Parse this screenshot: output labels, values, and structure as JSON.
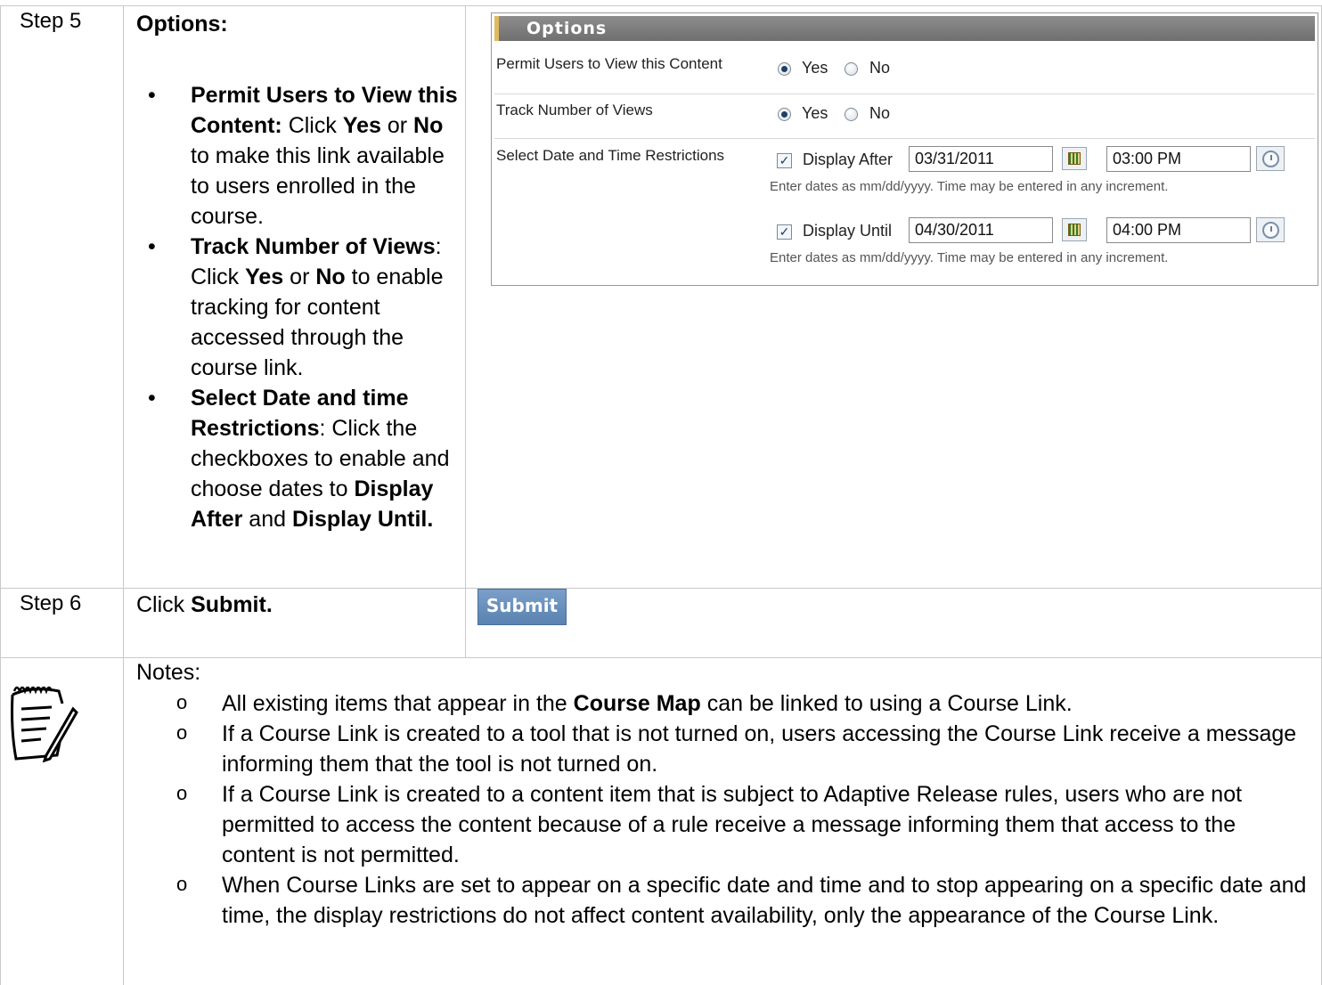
{
  "step5": {
    "label": "Step 5",
    "heading": "Options:",
    "bullets": [
      {
        "bold": "Permit Users to View this Content:",
        "t1": " Click ",
        "b2": "Yes",
        "t2": " or ",
        "b3": "No",
        "t3": " to make this link available to users enrolled in the course."
      },
      {
        "bold": "Track Number of Views",
        "t1": ": Click ",
        "b2": "Yes",
        "t2": " or ",
        "b3": "No",
        "t3": " to enable tracking for content accessed through the course link."
      },
      {
        "bold": "Select Date and time Restrictions",
        "t1": ": Click the checkboxes to enable and choose dates to ",
        "b2": "Display After",
        "t2": " and ",
        "b3": "Display Until."
      }
    ]
  },
  "options_panel": {
    "title": "Options",
    "rows": {
      "permit_label": "Permit Users to View this Content",
      "track_label": "Track Number of Views",
      "date_label": "Select Date and Time Restrictions"
    },
    "yes": "Yes",
    "no": "No",
    "display_after": "Display After",
    "display_until": "Display Until",
    "after_date": "03/31/2011",
    "after_time": "03:00 PM",
    "until_date": "04/30/2011",
    "until_time": "04:00 PM",
    "hint": "Enter dates as mm/dd/yyyy. Time may be entered in any increment.",
    "checkmark": "✓"
  },
  "step6": {
    "label": "Step 6",
    "text_pre": "Click ",
    "text_bold": "Submit.",
    "button": "Submit"
  },
  "notes": {
    "heading": "Notes:",
    "items": [
      {
        "pre": "All existing items that appear in the ",
        "bold": "Course Map",
        "post": " can be linked to using a Course Link."
      },
      {
        "pre": "If a Course Link is created to a tool that is not turned on, users accessing the Course Link receive a message informing them that the tool is not turned on.",
        "bold": "",
        "post": ""
      },
      {
        "pre": "If a Course Link is created to a content item that is subject to Adaptive Release rules, users who are not permitted to access the content because of a rule receive a message informing them that access to the content is not permitted.",
        "bold": "",
        "post": ""
      },
      {
        "pre": "When Course Links are set to appear on a specific date and time and to stop appearing on a specific date and time, the display restrictions do not affect content availability, only the appearance of the Course Link.",
        "bold": "",
        "post": ""
      }
    ]
  }
}
